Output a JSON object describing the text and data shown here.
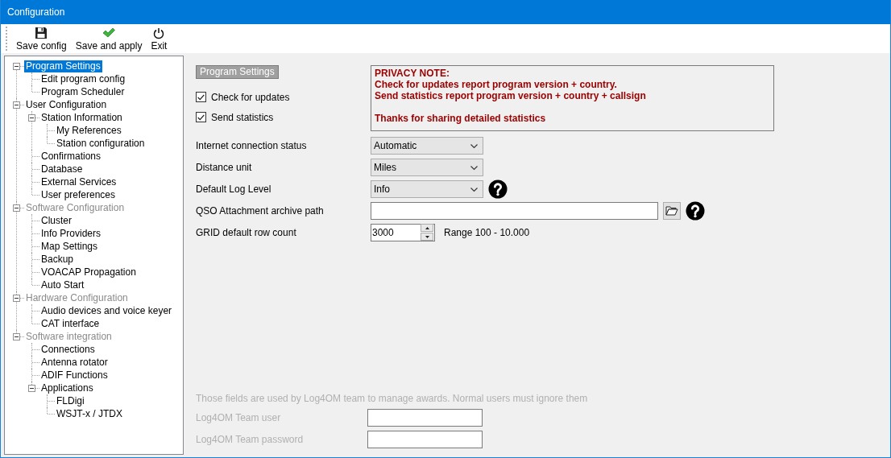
{
  "window": {
    "title": "Configuration"
  },
  "toolbar": [
    {
      "kind": "save",
      "label": "Save config"
    },
    {
      "kind": "apply",
      "label": "Save and apply"
    },
    {
      "kind": "exit",
      "label": "Exit"
    }
  ],
  "tree": [
    {
      "label": "Program Settings",
      "selected": true,
      "disabled": false,
      "expanded": true,
      "children": [
        {
          "label": "Edit program config",
          "selected": false,
          "disabled": false
        },
        {
          "label": "Program Scheduler",
          "selected": false,
          "disabled": false
        }
      ]
    },
    {
      "label": "User Configuration",
      "selected": false,
      "disabled": false,
      "expanded": true,
      "children": [
        {
          "label": "Station Information",
          "selected": false,
          "disabled": false,
          "expanded": true,
          "children": [
            {
              "label": "My References",
              "selected": false,
              "disabled": false
            },
            {
              "label": "Station configuration",
              "selected": false,
              "disabled": false
            }
          ]
        },
        {
          "label": "Confirmations",
          "selected": false,
          "disabled": false
        },
        {
          "label": "Database",
          "selected": false,
          "disabled": false
        },
        {
          "label": "External Services",
          "selected": false,
          "disabled": false
        },
        {
          "label": "User preferences",
          "selected": false,
          "disabled": false
        }
      ]
    },
    {
      "label": "Software Configuration",
      "selected": false,
      "disabled": true,
      "expanded": true,
      "children": [
        {
          "label": "Cluster",
          "selected": false,
          "disabled": false
        },
        {
          "label": "Info Providers",
          "selected": false,
          "disabled": false
        },
        {
          "label": "Map Settings",
          "selected": false,
          "disabled": false
        },
        {
          "label": "Backup",
          "selected": false,
          "disabled": false
        },
        {
          "label": "VOACAP Propagation",
          "selected": false,
          "disabled": false
        },
        {
          "label": "Auto Start",
          "selected": false,
          "disabled": false
        }
      ]
    },
    {
      "label": "Hardware Configuration",
      "selected": false,
      "disabled": true,
      "expanded": true,
      "children": [
        {
          "label": "Audio devices and voice keyer",
          "selected": false,
          "disabled": false
        },
        {
          "label": "CAT interface",
          "selected": false,
          "disabled": false
        }
      ]
    },
    {
      "label": "Software integration",
      "selected": false,
      "disabled": true,
      "expanded": true,
      "children": [
        {
          "label": "Connections",
          "selected": false,
          "disabled": false
        },
        {
          "label": "Antenna rotator",
          "selected": false,
          "disabled": false
        },
        {
          "label": "ADIF Functions",
          "selected": false,
          "disabled": false
        },
        {
          "label": "Applications",
          "selected": false,
          "disabled": false,
          "expanded": true,
          "children": [
            {
              "label": "FLDigi",
              "selected": false,
              "disabled": false
            },
            {
              "label": "WSJT-x / JTDX",
              "selected": false,
              "disabled": false
            }
          ]
        }
      ]
    }
  ],
  "section_label": "Program Settings",
  "checkboxes": [
    {
      "label": "Check for updates",
      "checked": true
    },
    {
      "label": "Send statistics",
      "checked": true
    }
  ],
  "privacy_note": {
    "paragraphs": [
      "PRIVACY NOTE:\nCheck for updates report program version + country.\nSend statistics report program version + country + callsign",
      "Thanks for sharing detailed statistics"
    ]
  },
  "settings": [
    {
      "kind": "dropdown",
      "label": "Internet connection status",
      "value": "Automatic",
      "help": false
    },
    {
      "kind": "dropdown",
      "label": "Distance unit",
      "value": "Miles",
      "help": false
    },
    {
      "kind": "dropdown",
      "label": "Default Log Level",
      "value": "Info",
      "help": true
    },
    {
      "kind": "path",
      "label": "QSO Attachment archive path",
      "help": true
    },
    {
      "kind": "spinner",
      "label": "GRID default row count",
      "value": "3000",
      "note": "Range 100 - 10.000",
      "help": false
    }
  ],
  "team": {
    "disabled": true,
    "note": "Those fields are used by Log4OM team to manage awards. Normal users must ignore them",
    "fields": [
      {
        "label": "Log4OM Team user"
      },
      {
        "label": "Log4OM Team password"
      }
    ]
  }
}
